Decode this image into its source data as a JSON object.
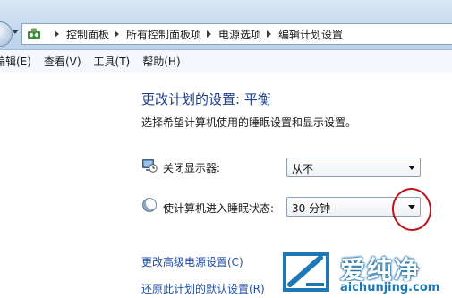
{
  "breadcrumb": [
    "控制面板",
    "所有控制面板项",
    "电源选项",
    "编辑计划设置"
  ],
  "menu": [
    "编辑(E)",
    "查看(V)",
    "工具(T)",
    "帮助(H)"
  ],
  "title": "更改计划的设置: 平衡",
  "subtitle": "选择希望计算机使用的睡眠设置和显示设置。",
  "settings": [
    {
      "label": "关闭显示器:",
      "value": "从不",
      "icon": "monitor-clock-icon"
    },
    {
      "label": "使计算机进入睡眠状态:",
      "value": "30 分钟",
      "icon": "moon-sleep-icon"
    }
  ],
  "links": [
    "更改高级电源设置(C)",
    "还原此计划的默认设置(R)"
  ],
  "watermark": {
    "name": "爱纯净",
    "url": "aichunjing.com"
  },
  "colors": {
    "title": "#1f3f8a",
    "link": "#1f4fa8",
    "highlight": "#c0141c"
  }
}
